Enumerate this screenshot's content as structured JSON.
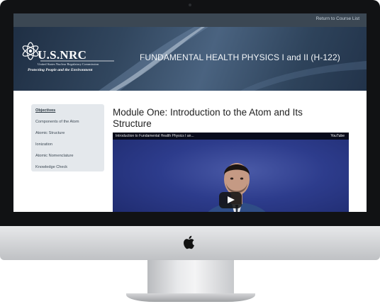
{
  "header": {
    "return_link": "Return to Course List",
    "org_name": "U.S.NRC",
    "org_full": "United States Nuclear Regulatory Commission",
    "org_tagline": "Protecting People and the Environment",
    "course_title": "FUNDAMENTAL HEALTH PHYSICS I and II (H-122)"
  },
  "sidebar": {
    "items": [
      {
        "label": "Objectives"
      },
      {
        "label": "Components of the Atom"
      },
      {
        "label": "Atomic Structure"
      },
      {
        "label": "Ionization"
      },
      {
        "label": "Atomic Nomenclature"
      },
      {
        "label": "Knowledge Check"
      }
    ]
  },
  "main": {
    "module_title": "Module One: Introduction to the Atom and Its Structure",
    "video": {
      "caption": "Introduction to Fundamental Health Physics I an...",
      "brand": "YouTube"
    }
  },
  "colors": {
    "topbar": "#3b4753",
    "banner": "#31465e",
    "sidebar_bg": "#e4e8ec",
    "video_bg": "#2d3c8c"
  },
  "icons": [
    "atom-logo-icon",
    "play-icon",
    "apple-logo-icon"
  ]
}
